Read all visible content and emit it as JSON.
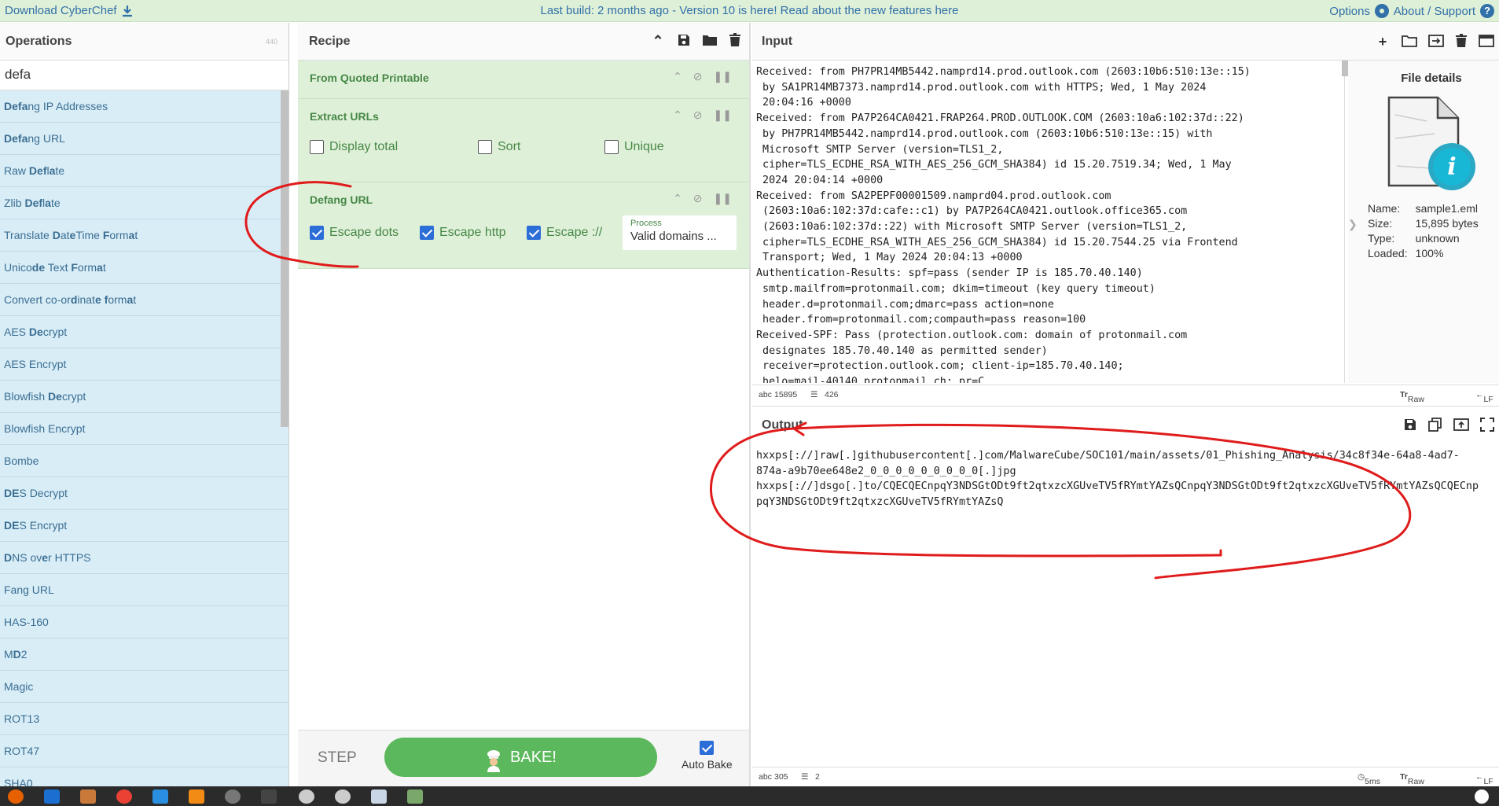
{
  "banner": {
    "download": "Download CyberChef",
    "message": "Last build: 2 months ago - Version 10 is here! Read about the new features here",
    "options": "Options",
    "about": "About / Support"
  },
  "operations": {
    "title": "Operations",
    "count": "440",
    "search_value": "defa",
    "items": [
      "Defang IP Addresses",
      "Defang URL",
      "Raw Deflate",
      "Zlib Deflate",
      "Translate DateTime Format",
      "Unicode Text Format",
      "Convert co-ordinate format",
      "AES Decrypt",
      "AES Encrypt",
      "Blowfish Decrypt",
      "Blowfish Encrypt",
      "Bombe",
      "DES Decrypt",
      "DES Encrypt",
      "DNS over HTTPS",
      "Fang URL",
      "HAS-160",
      "MD2",
      "Magic",
      "ROT13",
      "ROT47",
      "SHA0"
    ]
  },
  "recipe": {
    "title": "Recipe",
    "ops": {
      "quoted": {
        "name": "From Quoted Printable"
      },
      "extract": {
        "name": "Extract URLs",
        "display_total": "Display total",
        "sort": "Sort",
        "unique": "Unique",
        "display_total_checked": false,
        "sort_checked": false,
        "unique_checked": false
      },
      "defang": {
        "name": "Defang URL",
        "escape_dots": "Escape dots",
        "escape_http": "Escape http",
        "escape_colon": "Escape ://",
        "escape_dots_checked": true,
        "escape_http_checked": true,
        "escape_colon_checked": true,
        "process_label": "Process",
        "process_value": "Valid domains ..."
      }
    },
    "step": "STEP",
    "bake": "BAKE!",
    "auto_bake": "Auto Bake",
    "auto_bake_checked": true
  },
  "input": {
    "title": "Input",
    "text": "Received: from PH7PR14MB5442.namprd14.prod.outlook.com (2603:10b6:510:13e::15)\n by SA1PR14MB7373.namprd14.prod.outlook.com with HTTPS; Wed, 1 May 2024\n 20:04:16 +0000\nReceived: from PA7P264CA0421.FRAP264.PROD.OUTLOOK.COM (2603:10a6:102:37d::22)\n by PH7PR14MB5442.namprd14.prod.outlook.com (2603:10b6:510:13e::15) with\n Microsoft SMTP Server (version=TLS1_2,\n cipher=TLS_ECDHE_RSA_WITH_AES_256_GCM_SHA384) id 15.20.7519.34; Wed, 1 May\n 2024 20:04:14 +0000\nReceived: from SA2PEPF00001509.namprd04.prod.outlook.com\n (2603:10a6:102:37d:cafe::c1) by PA7P264CA0421.outlook.office365.com\n (2603:10a6:102:37d::22) with Microsoft SMTP Server (version=TLS1_2,\n cipher=TLS_ECDHE_RSA_WITH_AES_256_GCM_SHA384) id 15.20.7544.25 via Frontend\n Transport; Wed, 1 May 2024 20:04:13 +0000\nAuthentication-Results: spf=pass (sender IP is 185.70.40.140)\n smtp.mailfrom=protonmail.com; dkim=timeout (key query timeout)\n header.d=protonmail.com;dmarc=pass action=none\n header.from=protonmail.com;compauth=pass reason=100\nReceived-SPF: Pass (protection.outlook.com: domain of protonmail.com\n designates 185.70.40.140 as permitted sender)\n receiver=protection.outlook.com; client-ip=185.70.40.140;\n helo=mail-40140.protonmail.ch; pr=C",
    "chars": "15895",
    "lines": "426",
    "raw_bytes": "Raw Bytes",
    "eol": "LF"
  },
  "file_details": {
    "title": "File details",
    "name_label": "Name:",
    "name": "sample1.eml",
    "size_label": "Size:",
    "size": "15,895 bytes",
    "type_label": "Type:",
    "type": "unknown",
    "loaded_label": "Loaded:",
    "loaded": "100%"
  },
  "output": {
    "title": "Output",
    "text": "hxxps[://]raw[.]githubusercontent[.]com/MalwareCube/SOC101/main/assets/01_Phishing_Analysis/34c8f34e-64a8-4ad7-\n874a-a9b70ee648e2_0_0_0_0_0_0_0_0_0[.]jpg\nhxxps[://]dsgo[.]to/CQECQECnpqY3NDSGtODt9ft2qtxzcXGUveTV5fRYmtYAZsQCnpqY3NDSGtODt9ft2qtxzcXGUveTV5fRYmtYAZsQCQECnp\npqY3NDSGtODt9ft2qtxzcXGUveTV5fRYmtYAZsQ",
    "chars": "305",
    "lines": "2",
    "time": "5ms",
    "raw_bytes": "Raw Bytes",
    "eol": "LF"
  },
  "colors": {
    "banner_bg": "#dff0d8",
    "op_list_bg": "#d9edf7",
    "bake_green": "#5cb85c",
    "annotation_red": "#e01b1b"
  }
}
